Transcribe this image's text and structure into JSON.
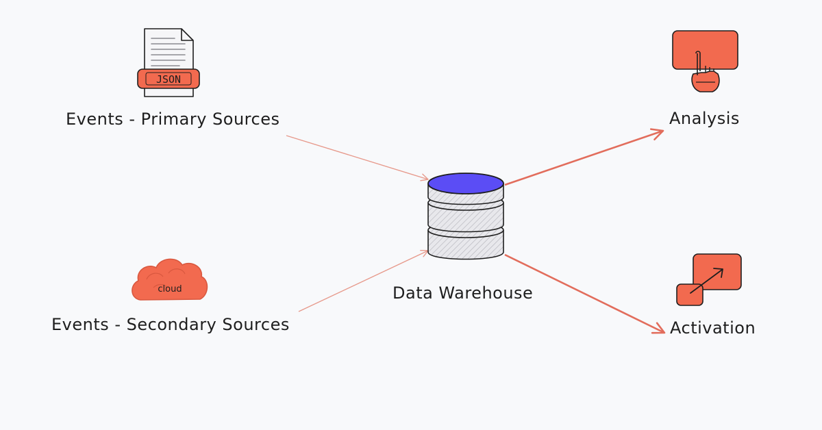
{
  "nodes": {
    "primary_sources": {
      "label": "Events - Primary Sources",
      "icon": "json-file-icon",
      "icon_text": "JSON"
    },
    "secondary_sources": {
      "label": "Events - Secondary Sources",
      "icon": "cloud-icon",
      "icon_text": "cloud"
    },
    "warehouse": {
      "label": "Data Warehouse",
      "icon": "database-icon"
    },
    "analysis": {
      "label": "Analysis",
      "icon": "monitor-touch-icon"
    },
    "activation": {
      "label": "Activation",
      "icon": "launch-arrow-icon"
    }
  },
  "edges": [
    {
      "from": "Events - Primary Sources",
      "to": "Data Warehouse"
    },
    {
      "from": "Events - Secondary Sources",
      "to": "Data Warehouse"
    },
    {
      "from": "Data Warehouse",
      "to": "Analysis"
    },
    {
      "from": "Data Warehouse",
      "to": "Activation"
    }
  ],
  "colors": {
    "accent": "#f26a4f",
    "accent_dark": "#d9583f",
    "stroke": "#1e1e1e",
    "db_top": "#5b4df5",
    "db_body": "#d6d6da",
    "inbound_arrow": "#e79a8c",
    "outbound_arrow": "#e26d5c",
    "background": "#f8f9fb"
  }
}
